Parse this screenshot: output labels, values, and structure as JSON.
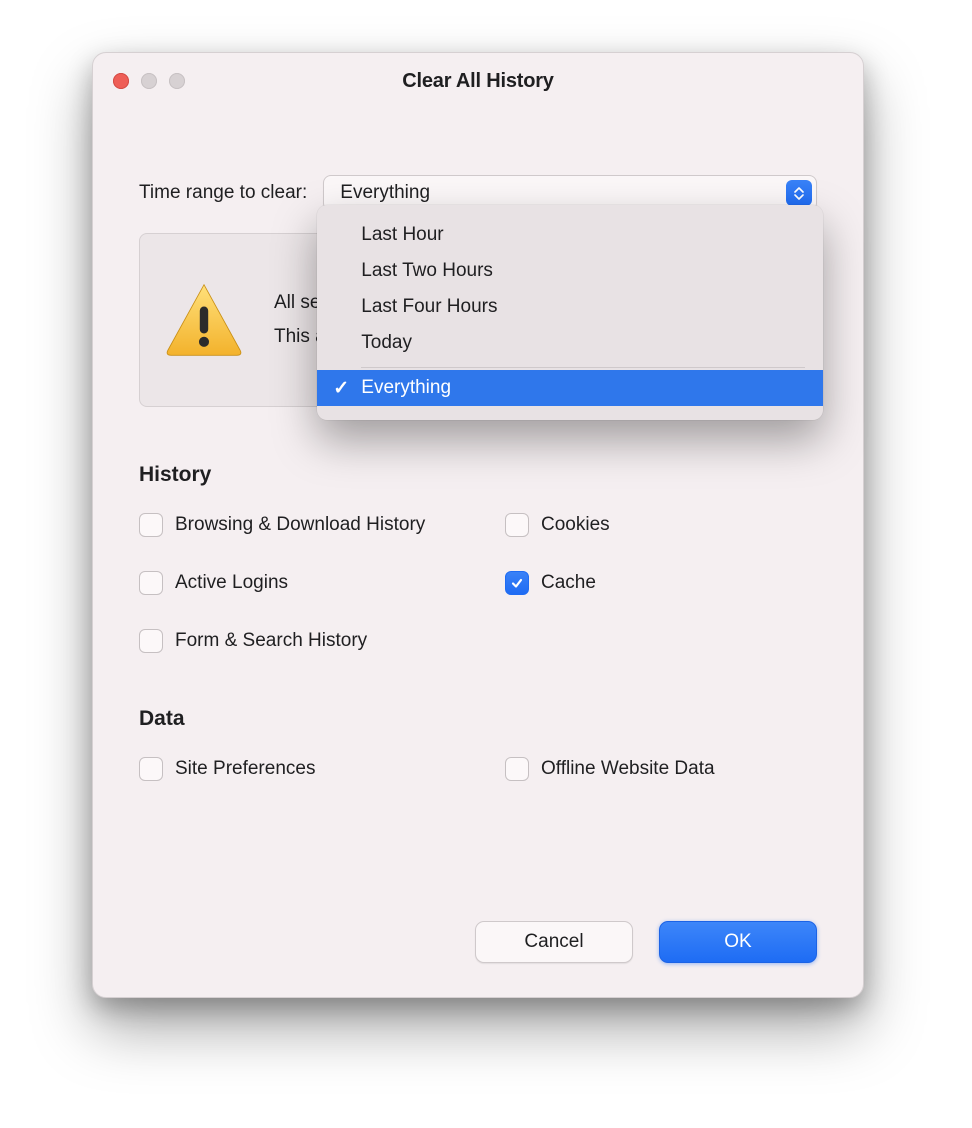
{
  "window": {
    "title": "Clear All History"
  },
  "time_range": {
    "label": "Time range to clear:",
    "selected": "Everything",
    "options": {
      "0": "Last Hour",
      "1": "Last Two Hours",
      "2": "Last Four Hours",
      "3": "Today",
      "4": "Everything"
    },
    "selected_index": 4
  },
  "warning": {
    "line1": "All selected items will be cleared.",
    "line2": "This action cannot be undone.",
    "visible_line1": "All sel",
    "visible_line2": "This a"
  },
  "history_section": {
    "title": "History",
    "items": {
      "browsing": {
        "label": "Browsing & Download History",
        "checked": false
      },
      "cookies": {
        "label": "Cookies",
        "checked": false
      },
      "logins": {
        "label": "Active Logins",
        "checked": false
      },
      "cache": {
        "label": "Cache",
        "checked": true
      },
      "forms": {
        "label": "Form & Search History",
        "checked": false
      }
    }
  },
  "data_section": {
    "title": "Data",
    "items": {
      "siteprefs": {
        "label": "Site Preferences",
        "checked": false
      },
      "offline": {
        "label": "Offline Website Data",
        "checked": false
      }
    }
  },
  "buttons": {
    "cancel": "Cancel",
    "ok": "OK"
  }
}
